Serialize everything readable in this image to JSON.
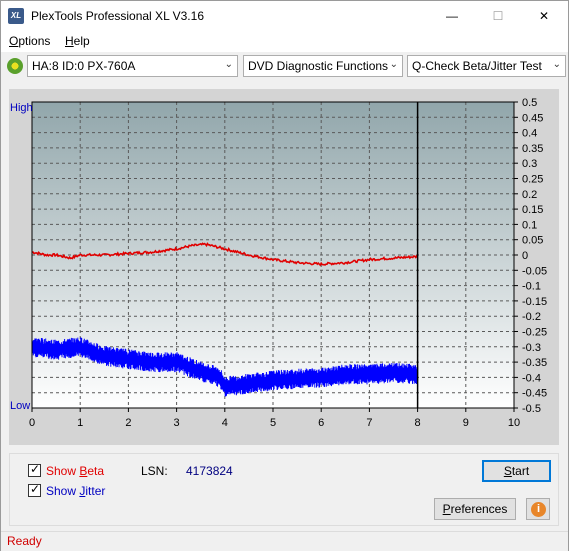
{
  "window": {
    "title": "PlexTools Professional XL V3.16",
    "icon_text": "XL",
    "minimize_glyph": "—",
    "maximize_glyph": "☐",
    "close_glyph": "✕"
  },
  "menu": {
    "options_label": "Options",
    "options_accel": "O",
    "options_rest": "ptions",
    "help_label": "Help",
    "help_accel": "H",
    "help_rest": "elp"
  },
  "toolbar": {
    "drive": "HA:8 ID:0  PX-760A",
    "function": "DVD Diagnostic Functions",
    "test": "Q-Check Beta/Jitter Test"
  },
  "chart_data": {
    "type": "line",
    "left_axis_labels": {
      "top": "High",
      "bottom": "Low"
    },
    "x": {
      "ticks": [
        0,
        1,
        2,
        3,
        4,
        5,
        6,
        7,
        8,
        9,
        10
      ],
      "range": [
        0,
        10
      ]
    },
    "y_right": {
      "ticks": [
        "0.5",
        "0.45",
        "0.4",
        "0.35",
        "0.3",
        "0.25",
        "0.2",
        "0.15",
        "0.1",
        "0.05",
        "0",
        "-0.05",
        "-0.1",
        "-0.15",
        "-0.2",
        "-0.25",
        "-0.3",
        "-0.35",
        "-0.4",
        "-0.45",
        "-0.5"
      ],
      "range": [
        -0.5,
        0.5
      ]
    },
    "grid": true,
    "end_marker_x": 8,
    "series": [
      {
        "color": "#e00000",
        "x": [
          0,
          0.3,
          0.5,
          0.8,
          1.0,
          1.5,
          2.0,
          2.5,
          3.0,
          3.3,
          3.6,
          4.0,
          4.5,
          5.0,
          5.5,
          6.0,
          6.5,
          7.0,
          7.5,
          8.0
        ],
        "y": [
          0.01,
          0.0,
          0.0,
          -0.01,
          0.0,
          0.0,
          0.005,
          0.01,
          0.02,
          0.03,
          0.035,
          0.02,
          0.0,
          -0.015,
          -0.025,
          -0.03,
          -0.025,
          -0.015,
          -0.01,
          -0.005
        ]
      },
      {
        "color": "#0000ff",
        "x": [
          0,
          0.5,
          1.0,
          1.5,
          2.0,
          2.5,
          3.0,
          3.5,
          3.9,
          4.0,
          4.5,
          5.0,
          5.5,
          6.0,
          6.5,
          7.0,
          7.5,
          8.0
        ],
        "y": [
          -0.3,
          -0.31,
          -0.3,
          -0.33,
          -0.34,
          -0.35,
          -0.35,
          -0.38,
          -0.4,
          -0.43,
          -0.42,
          -0.41,
          -0.405,
          -0.4,
          -0.39,
          -0.39,
          -0.385,
          -0.39
        ],
        "noise": 0.022
      }
    ]
  },
  "controls": {
    "show_beta_label": "Show Beta",
    "show_beta_accel": "B",
    "show_beta_prefix": "Show ",
    "show_beta_rest": "eta",
    "show_beta_checked": true,
    "show_jitter_label": "Show Jitter",
    "show_jitter_prefix": "Show ",
    "show_jitter_accel": "J",
    "show_jitter_rest": "itter",
    "show_jitter_checked": true,
    "lsn_label": "LSN:",
    "lsn_value": "4173824",
    "start_label": "Start",
    "start_accel": "S",
    "start_rest": "tart",
    "preferences_label": "Preferences",
    "preferences_accel": "P",
    "preferences_rest": "references",
    "info_glyph": "i"
  },
  "status": {
    "text": "Ready"
  },
  "colors": {
    "beta": "#e00000",
    "jitter": "#0000ff",
    "status": "#d00000",
    "axis_label": "#0000c0"
  }
}
